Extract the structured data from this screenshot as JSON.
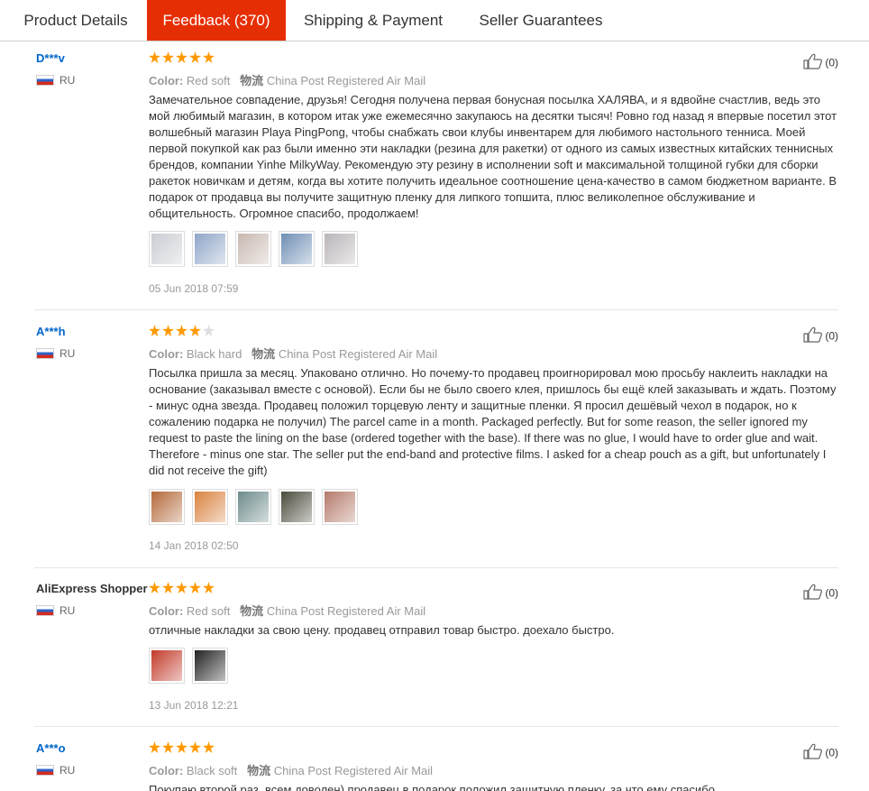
{
  "tabs": [
    {
      "label": "Product Details"
    },
    {
      "label": "Feedback (370)"
    },
    {
      "label": "Shipping & Payment"
    },
    {
      "label": "Seller Guarantees"
    }
  ],
  "colors": {
    "accent": "#e62e04",
    "star_on": "#ff9900",
    "star_off": "#dddddd",
    "user_link": "#0066cc"
  },
  "reviews": [
    {
      "user": "D***v",
      "country": "RU",
      "rating": 5,
      "color_label": "Color:",
      "color_value": "Red soft",
      "shipping_icon": "物流",
      "shipping": "China Post Registered Air Mail",
      "likes": "(0)",
      "text": "Замечательное совпадение, друзья! Сегодня получена первая бонусная посылка ХАЛЯВА, и я вдвойне счастлив, ведь это мой любимый магазин, в котором итак уже ежемесячно закупаюсь на десятки тысяч! Ровно год назад я впервые посетил этот волшебный магазин Playa PingPong, чтобы снабжать свои клубы инвентарем для любимого настольного тенниса. Моей первой покупкой как раз были именно эти накладки (резина для ракетки) от одного из самых известных китайских теннисных брендов, компании Yinhe MilkyWay. Рекомендую эту резину в исполнении soft и максимальной толщиной губки для сборки ракеток новичкам и детям, когда вы хотите получить идеальное соотношение цена-качество в самом бюджетном варианте. В подарок от продавца вы получите защитную пленку для липкого топшита, плюс великолепное обслуживание и общительность. Огромное спасибо, продолжаем!",
      "photos": [
        "#c9ccd2",
        "#8fa6c8",
        "#c8b8b0",
        "#6f8fb5",
        "#b9b4b8"
      ],
      "date": "05 Jun 2018 07:59"
    },
    {
      "user": "A***h",
      "country": "RU",
      "rating": 4,
      "color_label": "Color:",
      "color_value": "Black hard",
      "shipping_icon": "物流",
      "shipping": "China Post Registered Air Mail",
      "likes": "(0)",
      "text": "Посылка пришла за месяц. Упаковано отлично. Но почему-то продавец проигнорировал мою просьбу наклеить накладки на основание (заказывал вместе с основой). Если бы не было своего клея, пришлось бы ещё клей заказывать и ждать. Поэтому - минус одна звезда. Продавец положил торцевую ленту и защитные пленки. Я просил дешёвый чехол в подарок, но к сожалению подарка не получил) The parcel came in a month. Packaged perfectly. But for some reason, the seller ignored my request to paste the lining on the base (ordered together with the base). If there was no glue, I would have to order glue and wait. Therefore - minus one star. The seller put the end-band and protective films. I asked for a cheap pouch as a gift, but unfortunately I did not receive the gift)",
      "photos": [
        "#b4693a",
        "#d9823e",
        "#6d8a8a",
        "#4a4a3c",
        "#b37a6a"
      ],
      "date": "14 Jan 2018 02:50"
    },
    {
      "user": "AliExpress Shopper",
      "country": "RU",
      "rating": 5,
      "color_label": "Color:",
      "color_value": "Red soft",
      "shipping_icon": "物流",
      "shipping": "China Post Registered Air Mail",
      "likes": "(0)",
      "text": "отличные накладки за свою цену. продавец отправил товар быстро. доехало быстро.",
      "photos": [
        "#c23a2a",
        "#222222"
      ],
      "date": "13 Jun 2018 12:21"
    },
    {
      "user": "A***o",
      "country": "RU",
      "rating": 5,
      "color_label": "Color:",
      "color_value": "Black soft",
      "shipping_icon": "物流",
      "shipping": "China Post Registered Air Mail",
      "likes": "(0)",
      "text": "Покупаю второй раз, всем доволен) продавец в подарок положил защитную пленку, за что ему спасибо",
      "photos": [],
      "date": ""
    }
  ]
}
